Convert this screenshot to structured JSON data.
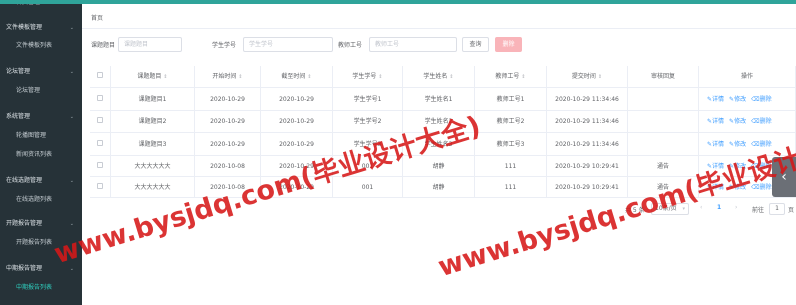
{
  "sidebar": {
    "items": [
      {
        "label": "首页管理",
        "type": "sub",
        "active": false
      },
      {
        "label": "文件模板管理",
        "type": "group",
        "active": false
      },
      {
        "label": "文件模板列表",
        "type": "sub",
        "active": false
      },
      {
        "label": "论坛管理",
        "type": "group",
        "active": false
      },
      {
        "label": "论坛管理",
        "type": "sub",
        "active": false
      },
      {
        "label": "系统管理",
        "type": "group",
        "active": false
      },
      {
        "label": "轮播图管理",
        "type": "sub",
        "active": false
      },
      {
        "label": "新闻资讯列表",
        "type": "sub",
        "active": false
      },
      {
        "label": "在线选题管理",
        "type": "group",
        "active": false
      },
      {
        "label": "在线选题列表",
        "type": "sub",
        "active": false
      },
      {
        "label": "开题报告管理",
        "type": "group",
        "active": false
      },
      {
        "label": "开题报告列表",
        "type": "sub",
        "active": false
      },
      {
        "label": "中期报告管理",
        "type": "group",
        "active": false
      },
      {
        "label": "中期报告列表",
        "type": "sub",
        "active": true
      }
    ]
  },
  "breadcrumb": "首页",
  "filters": [
    {
      "label": "课题题目",
      "placeholder": "课题题目"
    },
    {
      "label": "学生学号",
      "placeholder": "学生学号"
    },
    {
      "label": "教师工号",
      "placeholder": "教师工号"
    }
  ],
  "buttons": {
    "query": "查询",
    "delete": "删除"
  },
  "table": {
    "columns": [
      "",
      "课题题目",
      "开始时间",
      "截至时间",
      "学生学号",
      "学生姓名",
      "教师工号",
      "提交时间",
      "审核回复",
      "操作"
    ],
    "rows": [
      [
        "课题题目1",
        "2020-10-29",
        "2020-10-29",
        "学生学号1",
        "学生姓名1",
        "教师工号1",
        "2020-10-29 11:34:46",
        ""
      ],
      [
        "课题题目2",
        "2020-10-29",
        "2020-10-29",
        "学生学号2",
        "学生姓名2",
        "教师工号2",
        "2020-10-29 11:34:46",
        ""
      ],
      [
        "课题题目3",
        "2020-10-29",
        "2020-10-29",
        "学生学号3",
        "学生姓名3",
        "教师工号3",
        "2020-10-29 11:34:46",
        ""
      ],
      [
        "大大大大大大",
        "2020-10-08",
        "2020-10-29",
        "001",
        "胡静",
        "111",
        "2020-10-29 10:29:41",
        "通告"
      ],
      [
        "大大大大大大",
        "2020-10-08",
        "2020-10-29",
        "001",
        "胡静",
        "111",
        "2020-10-29 10:29:41",
        "通告"
      ]
    ],
    "actions": [
      "详情",
      "修改",
      "删除"
    ],
    "sort_icon": "sort-caret-icon"
  },
  "pagination": {
    "total": "共 5 条",
    "page_size": "10条/页",
    "current_page": "1",
    "goto_label": "前往",
    "goto_value": "1",
    "page_unit": "页"
  },
  "watermark": "www.bysjdq.com(毕业设计大全)",
  "colors": {
    "accent": "#2fa49a",
    "sidebar_bg": "#263238",
    "link": "#409eff",
    "delete_btn": "#f9b4b9",
    "watermark": "#d61818"
  }
}
